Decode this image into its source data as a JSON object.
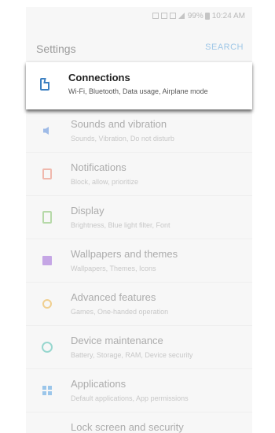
{
  "status_bar": {
    "battery": "99%",
    "time": "10:24 AM"
  },
  "header": {
    "title": "Settings",
    "search_label": "SEARCH"
  },
  "highlight": {
    "title": "Connections",
    "subtitle": "Wi-Fi, Bluetooth, Data usage, Airplane mode",
    "icon": "tablet-icon"
  },
  "items": [
    {
      "title": "Sounds and vibration",
      "subtitle": "Sounds, Vibration, Do not disturb",
      "icon": "speaker-icon"
    },
    {
      "title": "Notifications",
      "subtitle": "Block, allow, prioritize",
      "icon": "notification-icon"
    },
    {
      "title": "Display",
      "subtitle": "Brightness, Blue light filter, Font",
      "icon": "display-icon"
    },
    {
      "title": "Wallpapers and themes",
      "subtitle": "Wallpapers, Themes, Icons",
      "icon": "wallpaper-icon"
    },
    {
      "title": "Advanced features",
      "subtitle": "Games, One-handed operation",
      "icon": "gear-icon"
    },
    {
      "title": "Device maintenance",
      "subtitle": "Battery, Storage, RAM, Device security",
      "icon": "maintenance-icon"
    },
    {
      "title": "Applications",
      "subtitle": "Default applications, App permissions",
      "icon": "apps-icon"
    },
    {
      "title": "Lock screen and security",
      "subtitle": "",
      "icon": ""
    }
  ],
  "colors": {
    "accent": "#3b7fc1",
    "search": "#9fc7e7",
    "background": "#f7f7f7"
  }
}
